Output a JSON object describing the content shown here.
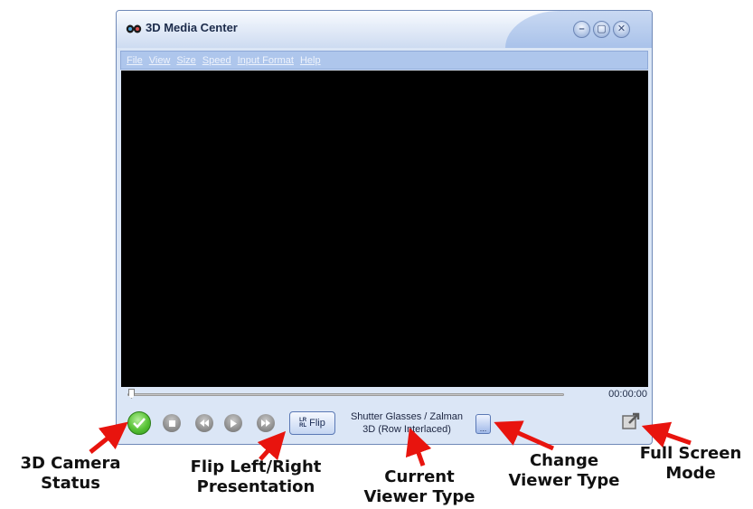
{
  "window": {
    "title": "3D Media Center",
    "controls": [
      "minimize",
      "maximize",
      "close"
    ]
  },
  "menu": [
    "File",
    "View",
    "Size",
    "Speed",
    "Input Format",
    "Help"
  ],
  "playback": {
    "time": "00:00:00",
    "position_fraction": 0.0,
    "flip_label": "Flip",
    "flip_icon_top": "LR",
    "flip_icon_bottom": "RL",
    "viewer_line1": "Shutter Glasses / Zalman",
    "viewer_line2": "3D (Row Interlaced)",
    "change_label": "..."
  },
  "annotations": {
    "camera_status": "3D Camera\nStatus",
    "flip": "Flip Left/Right\nPresentation",
    "viewer": "Current\nViewer Type",
    "change": "Change\nViewer Type",
    "fullscreen": "Full Screen\nMode"
  },
  "colors": {
    "video_bg": "#000000",
    "arrow": "#e8140e",
    "status_ok": "#57c234",
    "menubar": "#aec6ec"
  }
}
